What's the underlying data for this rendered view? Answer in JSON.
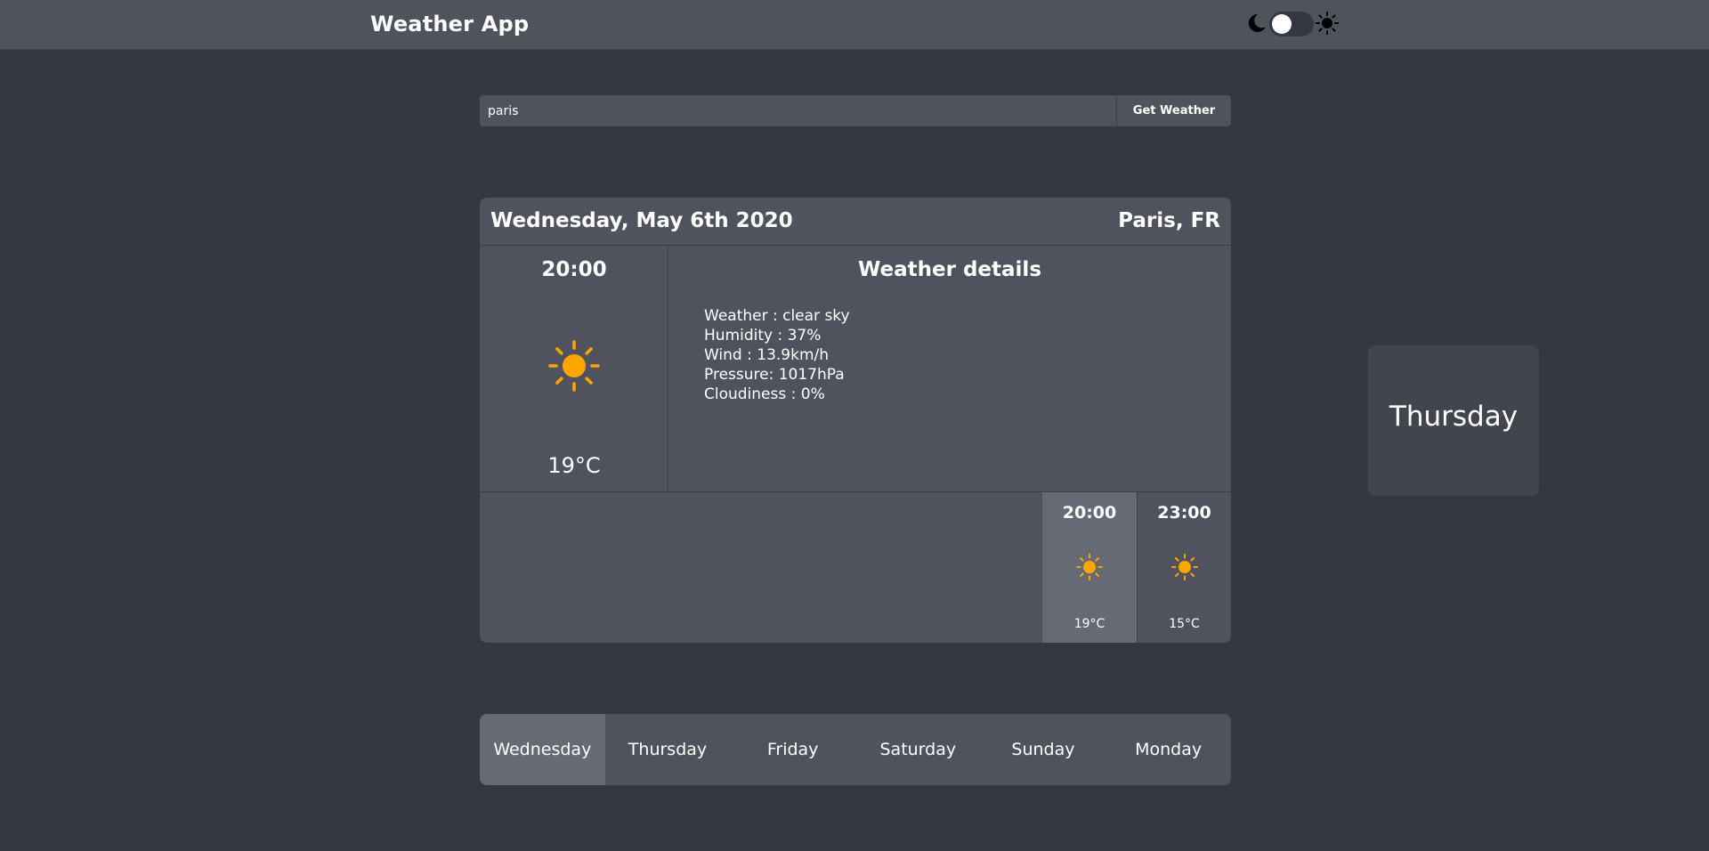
{
  "header": {
    "title": "Weather App",
    "theme_toggle": {
      "state": "dark",
      "left_icon": "moon-icon",
      "right_icon": "sun-icon"
    }
  },
  "search": {
    "value": "paris",
    "placeholder": "",
    "button_label": "Get Weather"
  },
  "card": {
    "date": "Wednesday, May 6th 2020",
    "city": "Paris, FR",
    "current": {
      "time": "20:00",
      "icon": "sun-icon",
      "temperature": "19°C"
    },
    "details": {
      "title": "Weather details",
      "items": [
        "Weather : clear sky",
        "Humidity : 37%",
        "Wind : 13.9km/h",
        "Pressure: 1017hPa",
        "Cloudiness : 0%"
      ]
    },
    "forecast": [
      {
        "time": "20:00",
        "icon": "sun-icon",
        "temperature": "19°C",
        "active": true
      },
      {
        "time": "23:00",
        "icon": "sun-icon",
        "temperature": "15°C",
        "active": false
      }
    ]
  },
  "day_preview": {
    "label": "Thursday"
  },
  "days": [
    {
      "label": "Wednesday",
      "active": true
    },
    {
      "label": "Thursday",
      "active": false
    },
    {
      "label": "Friday",
      "active": false
    },
    {
      "label": "Saturday",
      "active": false
    },
    {
      "label": "Sunday",
      "active": false
    },
    {
      "label": "Monday",
      "active": false
    }
  ],
  "colors": {
    "background": "#353841",
    "panel": "#50535d",
    "active": "#666a74",
    "sun": "#ffa500"
  }
}
